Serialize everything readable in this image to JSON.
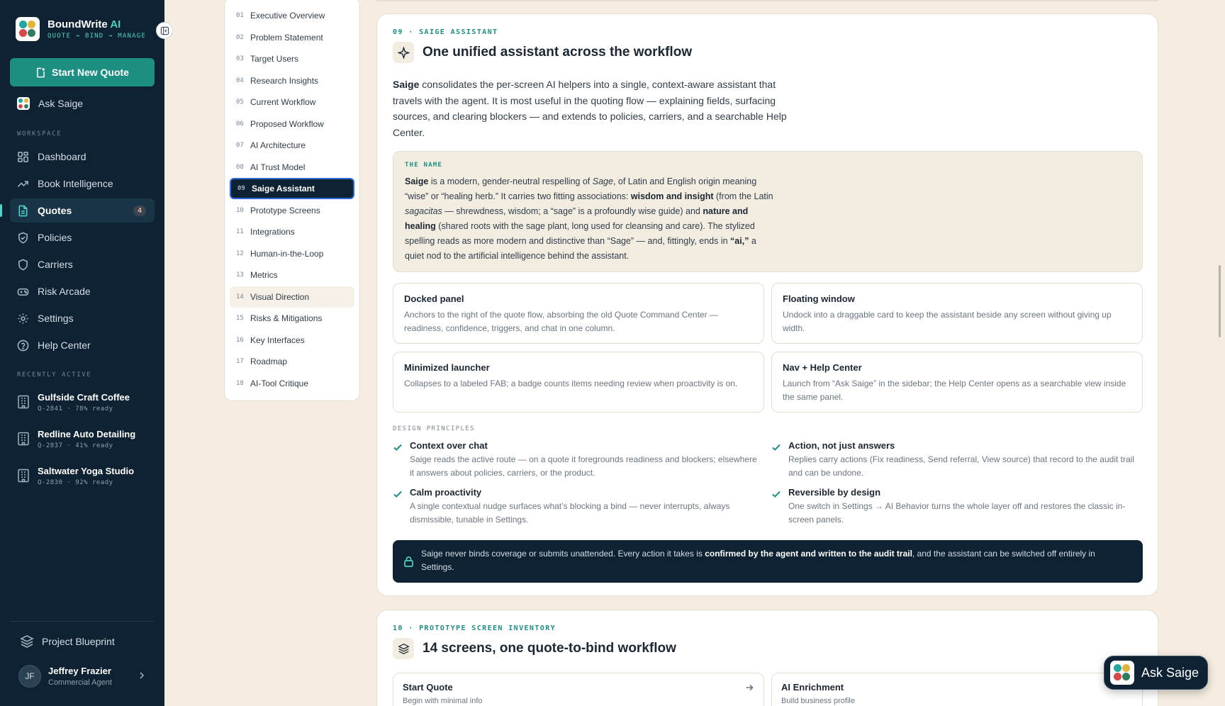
{
  "brand": {
    "name": "BoundWrite",
    "name_ai": "AI",
    "tagline": "QUOTE → BIND → MANAGE"
  },
  "sidebar": {
    "start_button": "Start New Quote",
    "ask_saige": "Ask Saige",
    "workspace_label": "WORKSPACE",
    "nav": [
      {
        "label": "Dashboard",
        "icon": "grid-icon"
      },
      {
        "label": "Book Intelligence",
        "icon": "trend-icon"
      },
      {
        "label": "Quotes",
        "icon": "document-icon",
        "badge": "4",
        "active": true
      },
      {
        "label": "Policies",
        "icon": "shield-check-icon"
      },
      {
        "label": "Carriers",
        "icon": "shield-icon"
      },
      {
        "label": "Risk Arcade",
        "icon": "gamepad-icon"
      },
      {
        "label": "Settings",
        "icon": "gear-icon"
      },
      {
        "label": "Help Center",
        "icon": "help-icon"
      }
    ],
    "recent_label": "RECENTLY ACTIVE",
    "recent": [
      {
        "name": "Gulfside Craft Coffee",
        "meta": "Q-2841 · 78% ready"
      },
      {
        "name": "Redline Auto Detailing",
        "meta": "Q-2837 · 41% ready"
      },
      {
        "name": "Saltwater Yoga Studio",
        "meta": "Q-2830 · 92% ready"
      }
    ],
    "blueprint": "Project Blueprint",
    "user": {
      "initials": "JF",
      "name": "Jeffrey Frazier",
      "role": "Commercial Agent"
    }
  },
  "toc": [
    {
      "num": "01",
      "label": "Executive Overview"
    },
    {
      "num": "02",
      "label": "Problem Statement"
    },
    {
      "num": "03",
      "label": "Target Users"
    },
    {
      "num": "04",
      "label": "Research Insights"
    },
    {
      "num": "05",
      "label": "Current Workflow"
    },
    {
      "num": "06",
      "label": "Proposed Workflow"
    },
    {
      "num": "07",
      "label": "AI Architecture"
    },
    {
      "num": "08",
      "label": "AI Trust Model"
    },
    {
      "num": "09",
      "label": "Saige Assistant",
      "active": true
    },
    {
      "num": "10",
      "label": "Prototype Screens"
    },
    {
      "num": "11",
      "label": "Integrations"
    },
    {
      "num": "12",
      "label": "Human-in-the-Loop"
    },
    {
      "num": "13",
      "label": "Metrics"
    },
    {
      "num": "14",
      "label": "Visual Direction",
      "hover": true
    },
    {
      "num": "15",
      "label": "Risks & Mitigations"
    },
    {
      "num": "16",
      "label": "Key Interfaces"
    },
    {
      "num": "17",
      "label": "Roadmap"
    },
    {
      "num": "18",
      "label": "AI-Tool Critique"
    }
  ],
  "section09": {
    "eyebrow": "09 · SAIGE ASSISTANT",
    "title": "One unified assistant across the workflow",
    "intro_bold": "Saige",
    "intro": " consolidates the per-screen AI helpers into a single, context-aware assistant that travels with the agent. It is most useful in the quoting flow — explaining fields, surfacing sources, and clearing blockers — and extends to policies, carriers, and a searchable Help Center.",
    "name_label": "THE NAME",
    "name_parts": {
      "p1": "Saige",
      "p2": " is a modern, gender-neutral respelling of ",
      "p3": "Sage",
      "p4": ", of Latin and English origin meaning “wise” or “healing herb.” It carries two fitting associations: ",
      "p5": "wisdom and insight",
      "p6": " (from the Latin ",
      "p7": "sagacitas",
      "p8": " — shrewdness, wisdom; a “sage” is a profoundly wise guide) and ",
      "p9": "nature and healing",
      "p10": " (shared roots with the sage plant, long used for cleansing and care). The stylized spelling reads as more modern and distinctive than “Sage” — and, fittingly, ends in ",
      "p11": "“ai,”",
      "p12": " a quiet nod to the artificial intelligence behind the assistant."
    },
    "modes": [
      {
        "title": "Docked panel",
        "desc": "Anchors to the right of the quote flow, absorbing the old Quote Command Center — readiness, confidence, triggers, and chat in one column."
      },
      {
        "title": "Floating window",
        "desc": "Undock into a draggable card to keep the assistant beside any screen without giving up width."
      },
      {
        "title": "Minimized launcher",
        "desc": "Collapses to a labeled FAB; a badge counts items needing review when proactivity is on."
      },
      {
        "title": "Nav + Help Center",
        "desc": "Launch from “Ask Saige” in the sidebar; the Help Center opens as a searchable view inside the same panel."
      }
    ],
    "principles_label": "DESIGN PRINCIPLES",
    "principles": [
      {
        "title": "Context over chat",
        "desc": "Saige reads the active route — on a quote it foregrounds readiness and blockers; elsewhere it answers about policies, carriers, or the product."
      },
      {
        "title": "Action, not just answers",
        "desc": "Replies carry actions (Fix readiness, Send referral, View source) that record to the audit trail and can be undone."
      },
      {
        "title": "Calm proactivity",
        "desc": "A single contextual nudge surfaces what’s blocking a bind — never interrupts, always dismissible, tunable in Settings."
      },
      {
        "title": "Reversible by design",
        "desc": "One switch in Settings → AI Behavior turns the whole layer off and restores the classic in-screen panels."
      }
    ],
    "notice": {
      "pre": "Saige never binds coverage or submits unattended. Every action it takes is ",
      "bold": "confirmed by the agent and written to the audit trail",
      "post": ", and the assistant can be switched off entirely in Settings."
    }
  },
  "section10": {
    "eyebrow": "10 · PROTOTYPE SCREEN INVENTORY",
    "title": "14 screens, one quote-to-bind workflow",
    "screens": [
      {
        "title": "Start Quote",
        "sub": "Begin with minimal info"
      },
      {
        "title": "AI Enrichment",
        "sub": "Build business profile"
      }
    ]
  },
  "fab": {
    "label": "Ask Saige"
  },
  "colors": {
    "sidebar": "#0e2233",
    "accent": "#1d8f82",
    "background": "#f5ede1"
  }
}
